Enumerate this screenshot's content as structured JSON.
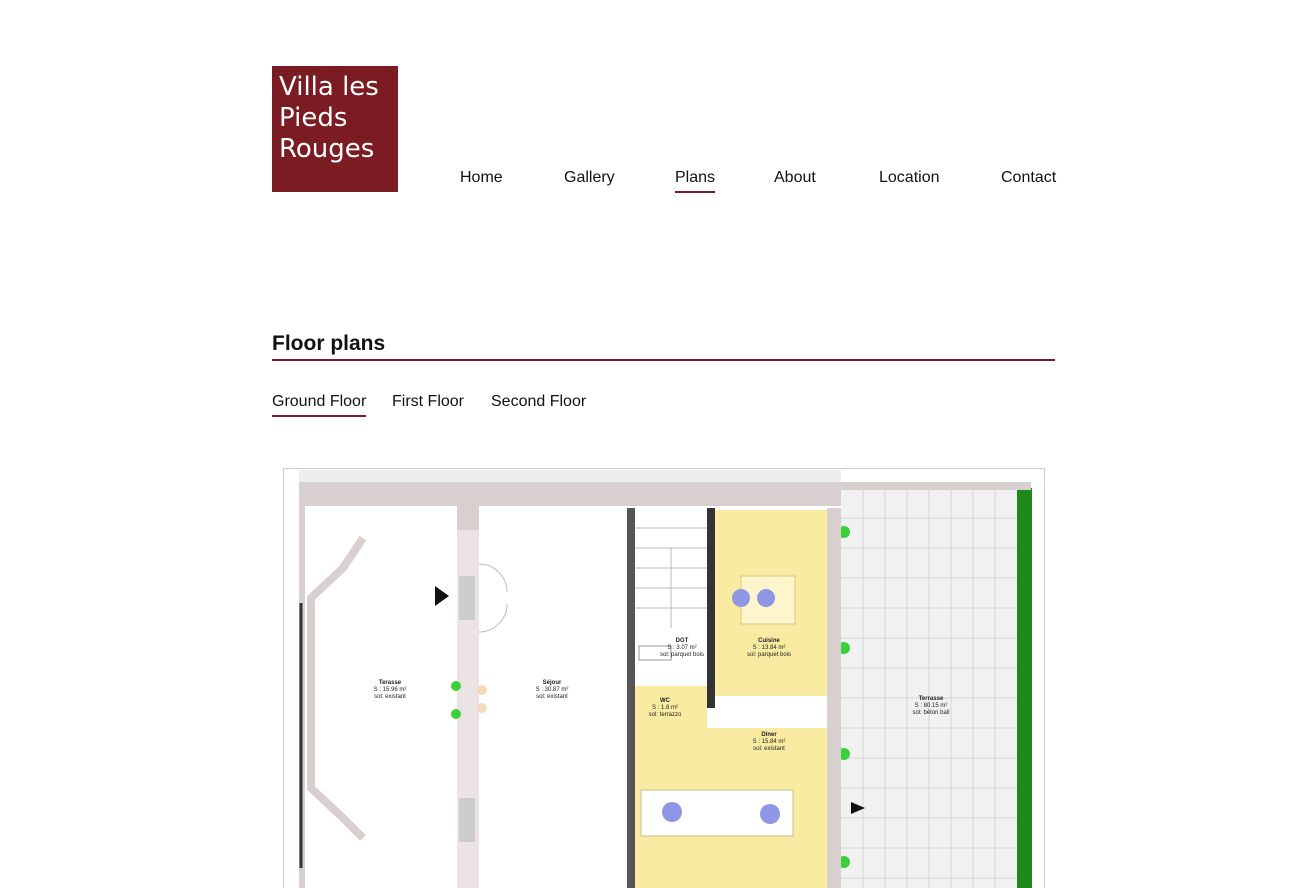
{
  "site": {
    "logo_line1": "Villa les",
    "logo_line2": "Pieds",
    "logo_line3": "Rouges"
  },
  "nav": {
    "items": [
      "Home",
      "Gallery",
      "Plans",
      "About",
      "Location",
      "Contact"
    ],
    "active": "Plans"
  },
  "section": {
    "title": "Floor plans"
  },
  "tabs": {
    "items": [
      "Ground Floor",
      "First Floor",
      "Second Floor"
    ],
    "active": "Ground Floor"
  },
  "plan": {
    "rooms": [
      {
        "name": "Terasse",
        "area": "S : 15.96 m²",
        "floor": "sol: existant"
      },
      {
        "name": "Séjour",
        "area": "S : 30.87 m²",
        "floor": "sol: existant"
      },
      {
        "name": "DGT",
        "area": "S : 3.07 m²",
        "floor": "sol: parquet bois"
      },
      {
        "name": "WC",
        "area": "S : 1.8 m²",
        "floor": "sol: terrazzo"
      },
      {
        "name": "Cuisine",
        "area": "S : 13.84 m²",
        "floor": "sol: parquet bois"
      },
      {
        "name": "Dîner",
        "area": "S : 15.84 m²",
        "floor": "sol: existant"
      },
      {
        "name": "Terrasse",
        "area": "S : 80.15 m²",
        "floor": "sol: béton ball"
      }
    ]
  },
  "colors": {
    "brand": "#7b1c22",
    "wall": "#d8cfcf",
    "room_yellow": "#f9eba2",
    "furniture_blue": "#8f96e6",
    "plant_green": "#3bd13b",
    "hedge_green": "#1e8a1e"
  }
}
